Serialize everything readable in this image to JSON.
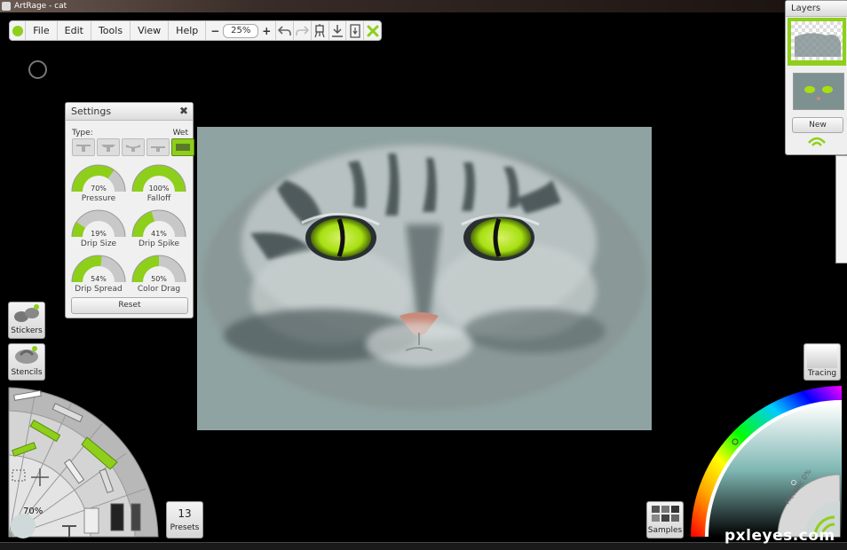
{
  "window": {
    "title": "ArtRage - cat"
  },
  "menubar": {
    "items": [
      "File",
      "Edit",
      "Tools",
      "View",
      "Help"
    ],
    "zoom_minus": "−",
    "zoom_value": "25%",
    "zoom_plus": "+"
  },
  "settings": {
    "title": "Settings",
    "close": "✖",
    "type_label": "Type:",
    "type_value": "Wet",
    "dials": [
      {
        "label": "Pressure",
        "value": "70%",
        "level": 0.7
      },
      {
        "label": "Falloff",
        "value": "100%",
        "level": 1.0
      },
      {
        "label": "Drip Size",
        "value": "19%",
        "level": 0.19
      },
      {
        "label": "Drip Spike",
        "value": "41%",
        "level": 0.41
      },
      {
        "label": "Drip Spread",
        "value": "54%",
        "level": 0.54
      },
      {
        "label": "Color Drag",
        "value": "50%",
        "level": 0.5
      }
    ],
    "reset": "Reset"
  },
  "left_tools": {
    "stickers": "Stickers",
    "stencils": "Stencils",
    "tool_size": "70%"
  },
  "presets": {
    "count": "13",
    "label": "Presets"
  },
  "samples": {
    "label": "Samples"
  },
  "tracing": {
    "label": "Tracing"
  },
  "layers": {
    "title": "Layers",
    "new_button": "New"
  },
  "color_picker": {
    "metallic": "Metallic 0%"
  },
  "watermark": "pxleyes.com",
  "colors": {
    "accent": "#8ecf1a",
    "canvas": "#8fa3a2",
    "eye": "#a6e010"
  }
}
